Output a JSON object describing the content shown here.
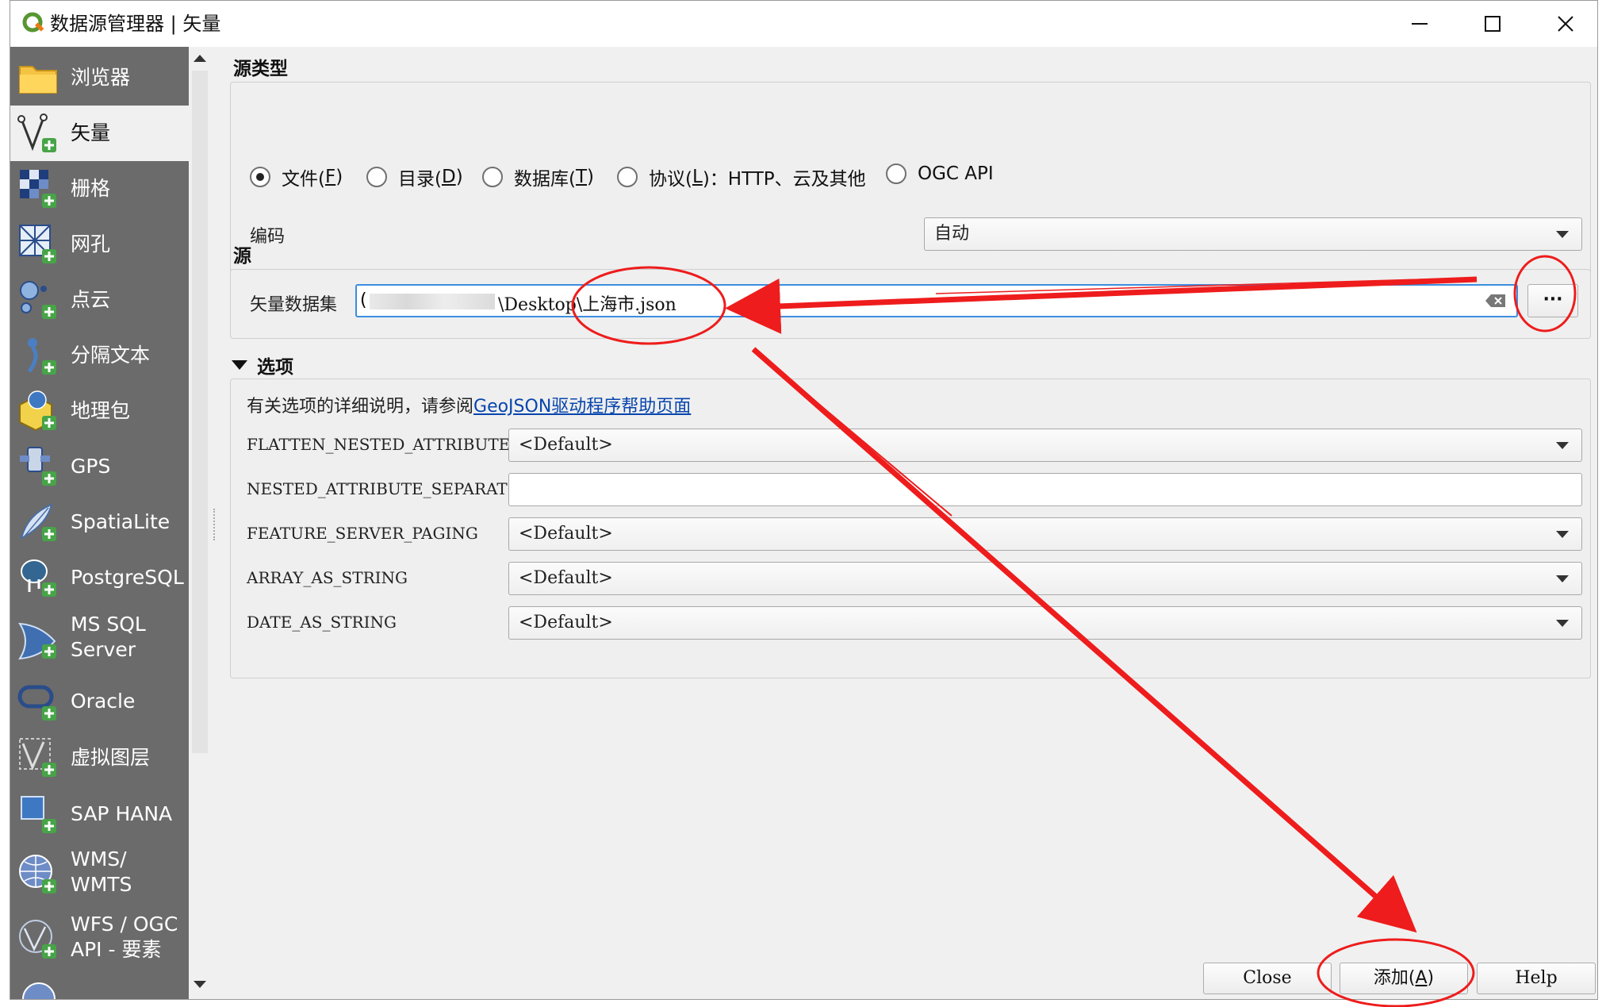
{
  "window": {
    "title": "数据源管理器 | 矢量",
    "minimize_icon": "minimize-icon",
    "maximize_icon": "maximize-icon",
    "close_icon": "close-icon"
  },
  "sidebar": {
    "items": [
      {
        "label": "浏览器",
        "icon": "folder-icon"
      },
      {
        "label": "矢量",
        "icon": "vector-icon"
      },
      {
        "label": "栅格",
        "icon": "raster-icon"
      },
      {
        "label": "网孔",
        "icon": "mesh-icon"
      },
      {
        "label": "点云",
        "icon": "point-cloud-icon"
      },
      {
        "label": "分隔文本",
        "icon": "delimited-text-icon"
      },
      {
        "label": "地理包",
        "icon": "geopackage-icon"
      },
      {
        "label": "GPS",
        "icon": "gps-icon"
      },
      {
        "label": "SpatiaLite",
        "icon": "spatialite-icon"
      },
      {
        "label": "PostgreSQL",
        "icon": "postgresql-icon"
      },
      {
        "label": "MS SQL\nServer",
        "line1": "MS SQL",
        "line2": "Server",
        "icon": "mssql-icon"
      },
      {
        "label": "Oracle",
        "icon": "oracle-icon"
      },
      {
        "label": "虚拟图层",
        "icon": "virtual-layer-icon"
      },
      {
        "label": "SAP HANA",
        "icon": "sap-hana-icon"
      },
      {
        "label": "WMS/\nWMTS",
        "line1": "WMS/",
        "line2": "WMTS",
        "icon": "wms-icon"
      },
      {
        "label": "WFS / OGC\nAPI - 要素",
        "line1": "WFS / OGC",
        "line2": "API - 要素",
        "icon": "wfs-icon"
      }
    ]
  },
  "source_type": {
    "title": "源类型",
    "options": [
      {
        "label": "文件(",
        "key": "F",
        "suffix": ")",
        "checked": true
      },
      {
        "label": "目录(",
        "key": "D",
        "suffix": ")",
        "checked": false
      },
      {
        "label": "数据库(",
        "key": "T",
        "suffix": ")",
        "checked": false
      },
      {
        "label": "协议(",
        "key": "L",
        "suffix": ")：HTTP、云及其他",
        "checked": false
      },
      {
        "label": "OGC API",
        "key": "",
        "suffix": "",
        "checked": false
      }
    ],
    "encoding_label": "编码",
    "encoding_value": "自动"
  },
  "source": {
    "title": "源",
    "dataset_label": "矢量数据集",
    "dataset_value_prefix": "(",
    "dataset_value": "\\Desktop\\上海市.json",
    "clear_icon": "clear-text-icon",
    "browse_label": "···"
  },
  "options": {
    "title": "选项",
    "help_text": "有关选项的详细说明，请参阅",
    "help_link": "GeoJSON驱动程序帮助页面",
    "rows": [
      {
        "label": "FLATTEN_NESTED_ATTRIBUTES",
        "value": "<Default>",
        "type": "combo"
      },
      {
        "label": "NESTED_ATTRIBUTE_SEPARATOR",
        "value": "",
        "type": "text"
      },
      {
        "label": "FEATURE_SERVER_PAGING",
        "value": "<Default>",
        "type": "combo"
      },
      {
        "label": "ARRAY_AS_STRING",
        "value": "<Default>",
        "type": "combo"
      },
      {
        "label": "DATE_AS_STRING",
        "value": "<Default>",
        "type": "combo"
      }
    ]
  },
  "buttons": {
    "close": "Close",
    "add": "添加(",
    "add_key": "A",
    "add_suffix": ")",
    "help": "Help"
  },
  "annotation_color": "#ee1c1c"
}
